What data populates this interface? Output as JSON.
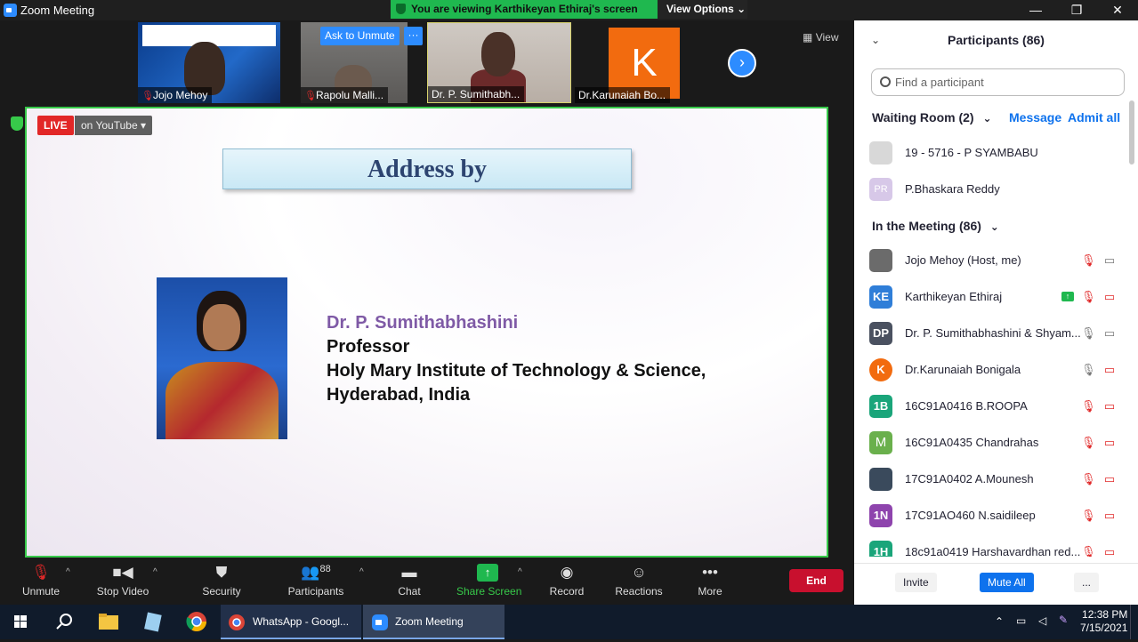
{
  "window": {
    "title": "Zoom Meeting",
    "minimize": "—",
    "maximize": "❐",
    "close": "✕"
  },
  "banner": {
    "viewing": "You are viewing Karthikeyan Ethiraj's screen",
    "view_options": "View Options"
  },
  "thumbnails": [
    {
      "name": "Jojo Mehoy",
      "muted": true
    },
    {
      "name": "Rapolu Malli...",
      "muted": true
    },
    {
      "name": "Dr. P. Sumithabh...",
      "muted": false
    },
    {
      "name": "Dr.Karunaiah Bo...",
      "muted": false,
      "initial": "K"
    }
  ],
  "thumb_actions": {
    "ask_unmute": "Ask to Unmute",
    "more": "···"
  },
  "view_label": "View",
  "livestream": {
    "live": "LIVE",
    "platform": "on YouTube"
  },
  "slide": {
    "title": "Address by",
    "name": "Dr. P. Sumithabhashini",
    "role": "Professor",
    "institution": "Holy Mary Institute of Technology & Science,",
    "location": "Hyderabad, India"
  },
  "participants_panel": {
    "title": "Participants (86)",
    "search_placeholder": "Find a participant",
    "waiting_room": {
      "label": "Waiting Room (2)",
      "message": "Message",
      "admit_all": "Admit all",
      "people": [
        {
          "name": "19 - 5716 - P SYAMBABU",
          "initials": "",
          "color": "#d8d8d8"
        },
        {
          "name": "P.Bhaskara Reddy",
          "initials": "PR",
          "color": "#d7c8e8"
        }
      ]
    },
    "in_meeting": {
      "label": "In the Meeting (86)",
      "people": [
        {
          "name": "Jojo Mehoy (Host, me)",
          "initials": "",
          "color": "#6b6b6b",
          "mic": "muted",
          "video": "on"
        },
        {
          "name": "Karthikeyan Ethiraj",
          "initials": "KE",
          "color": "#2f7ed8",
          "mic": "muted",
          "video": "off",
          "sharing": true
        },
        {
          "name": "Dr. P. Sumithabhashini & Shyam...",
          "initials": "DP",
          "color": "#4a5160",
          "mic": "on",
          "video": "on"
        },
        {
          "name": "Dr.Karunaiah Bonigala",
          "initials": "K",
          "color": "#f26b0f",
          "mic": "on",
          "video": "off"
        },
        {
          "name": "16C91A0416 B.ROOPA",
          "initials": "1B",
          "color": "#1aa57a",
          "mic": "muted",
          "video": "off"
        },
        {
          "name": "16C91A0435 Chandrahas",
          "initials": "M",
          "color": "#6ab04c",
          "mic": "muted",
          "video": "off"
        },
        {
          "name": "17C91A0402 A.Mounesh",
          "initials": "",
          "color": "#3a4a5c",
          "mic": "muted",
          "video": "off"
        },
        {
          "name": "17C91AO460 N.saidileep",
          "initials": "1N",
          "color": "#8e44ad",
          "mic": "muted",
          "video": "off"
        },
        {
          "name": "18c91a0419 Harshavardhan red...",
          "initials": "1H",
          "color": "#1aa57a",
          "mic": "muted",
          "video": "off"
        }
      ]
    },
    "footer": {
      "invite": "Invite",
      "mute_all": "Mute All",
      "more": "..."
    }
  },
  "toolbar": {
    "unmute": "Unmute",
    "stop_video": "Stop Video",
    "security": "Security",
    "participants": "Participants",
    "participants_count": "88",
    "chat": "Chat",
    "share_screen": "Share Screen",
    "record": "Record",
    "reactions": "Reactions",
    "more": "More",
    "end": "End"
  },
  "taskbar": {
    "whatsapp": "WhatsApp - Googl...",
    "zoom": "Zoom Meeting",
    "time": "12:38 PM",
    "date": "7/15/2021"
  },
  "colors": {
    "zoom_blue": "#2d8cff",
    "share_green": "#37c94a",
    "end_red": "#c8102e",
    "live_red": "#e22727"
  }
}
